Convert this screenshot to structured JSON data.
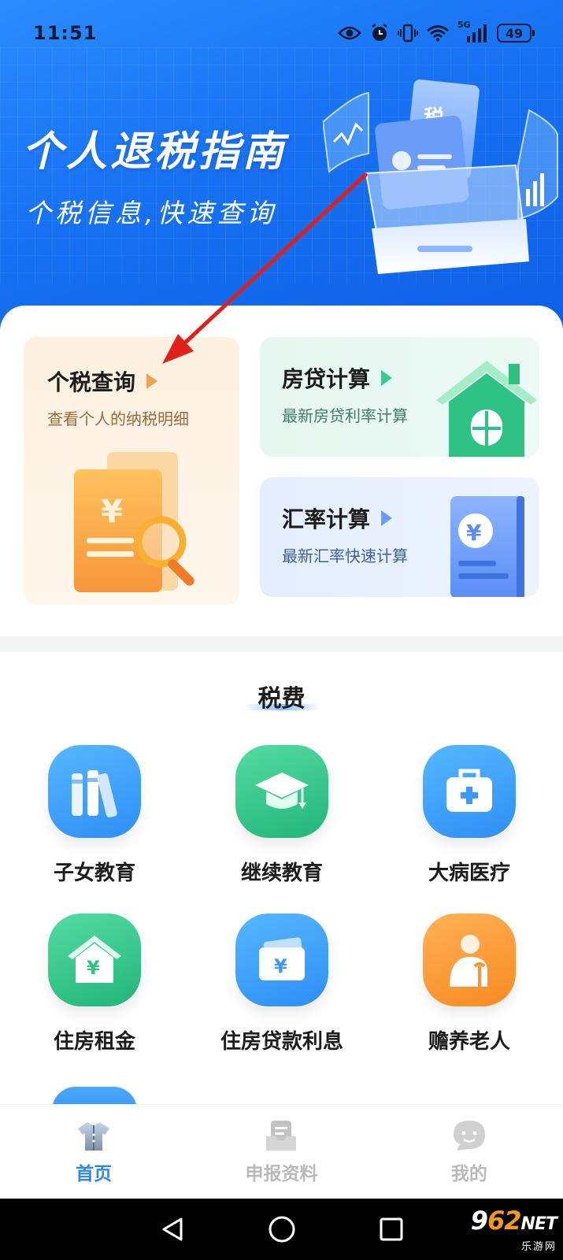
{
  "status_bar": {
    "time": "11:51",
    "network": "5G",
    "battery": "49"
  },
  "hero": {
    "title": "个人退税指南",
    "subtitle": "个税信息,快速查询",
    "illustration_text": "税"
  },
  "cards": {
    "tax_query": {
      "title": "个税查询",
      "desc": "查看个人的纳税明细",
      "icon_text": "¥"
    },
    "mortgage": {
      "title": "房贷计算",
      "desc": "最新房贷利率计算"
    },
    "exchange": {
      "title": "汇率计算",
      "desc": "最新汇率快速计算",
      "icon_text": "¥"
    }
  },
  "section": {
    "title": "税费",
    "items": [
      {
        "label": "子女教育",
        "icon": "books-icon",
        "color": "#3a9af6"
      },
      {
        "label": "继续教育",
        "icon": "graduation-cap-icon",
        "color": "#2ec285"
      },
      {
        "label": "大病医疗",
        "icon": "medical-kit-icon",
        "color": "#3a9af6"
      },
      {
        "label": "住房租金",
        "icon": "house-yuan-icon",
        "color": "#2ec285",
        "icon_text": "¥"
      },
      {
        "label": "住房贷款利息",
        "icon": "wallet-yuan-icon",
        "color": "#3a9af6",
        "icon_text": "¥"
      },
      {
        "label": "赡养老人",
        "icon": "elderly-icon",
        "color": "#f8942e"
      }
    ]
  },
  "bottom_nav": [
    {
      "label": "首页",
      "icon": "home-shirt-icon",
      "active": true
    },
    {
      "label": "申报资料",
      "icon": "file-box-icon",
      "active": false
    },
    {
      "label": "我的",
      "icon": "chat-face-icon",
      "active": false
    }
  ],
  "watermark": {
    "logo_prefix": "9",
    "logo_accent": "62",
    "logo_suffix": "NET",
    "sub": "乐游网"
  },
  "colors": {
    "accent": "#2f86e8",
    "hero_blue": "#1771f2",
    "green": "#2ec285",
    "orange": "#f8942e",
    "annotation": "#e0201b"
  }
}
